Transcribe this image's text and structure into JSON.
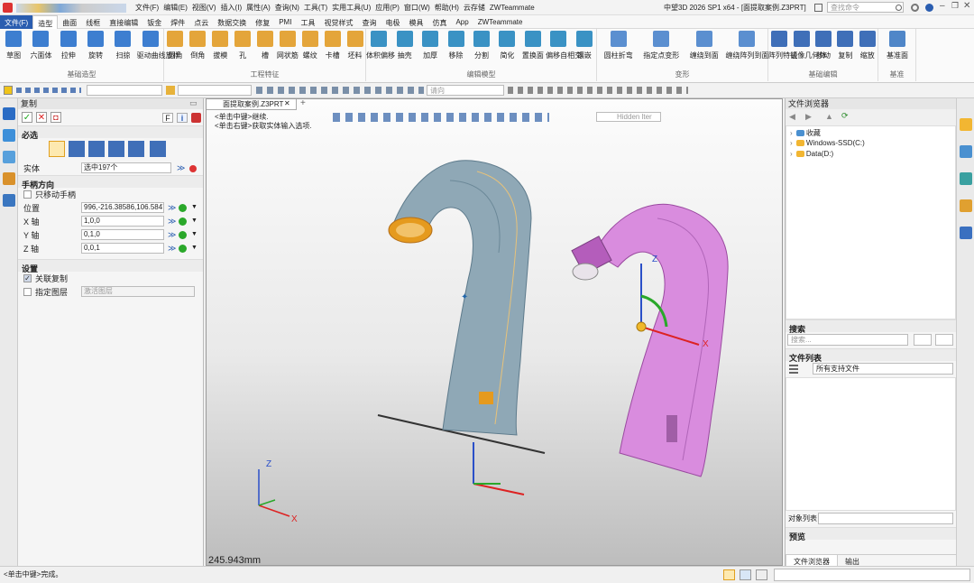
{
  "title_bar": {
    "quick_access_label": "文件(F)",
    "quick_menu": [
      "文件(F)",
      "编辑(E)",
      "视图(V)",
      "插入(I)",
      "属性(A)",
      "查询(N)",
      "工具(T)",
      "实用工具(U)",
      "应用(P)",
      "窗口(W)",
      "帮助(H)",
      "云存储",
      "ZWTeammate"
    ],
    "window_title": "中望3D 2026 SP1 x64 - [面提取案例.Z3PRT]",
    "search_placeholder": "查找命令"
  },
  "tabs": [
    "文件(F)",
    "造型",
    "曲面",
    "线框",
    "直接编辑",
    "钣金",
    "焊件",
    "点云",
    "数据交换",
    "修复",
    "PMI",
    "工具",
    "视觉样式",
    "查询",
    "电极",
    "模具",
    "仿真",
    "App",
    "ZWTeammate"
  ],
  "ribbon": {
    "groups": [
      {
        "label": "基础造型",
        "buttons": [
          "草图",
          "六面体",
          "拉伸",
          "旋转",
          "扫掠",
          "驱动曲线放样"
        ]
      },
      {
        "label": "工程特征",
        "buttons": [
          "圆角",
          "倒角",
          "拔模",
          "孔",
          "槽",
          "网状筋",
          "螺纹",
          "卡槽",
          "坯料"
        ]
      },
      {
        "label": "编辑模型",
        "buttons": [
          "体积偏移",
          "抽壳",
          "加厚",
          "移除",
          "分割",
          "简化",
          "置换面",
          "偏移自相交",
          "镶嵌"
        ]
      },
      {
        "label": "变形",
        "buttons": [
          "圆柱折弯",
          "指定点变形",
          "缠绕到面",
          "缠绕阵列到面"
        ]
      },
      {
        "label": "基础编辑",
        "buttons": [
          "阵列特征",
          "镜像几何体",
          "移动",
          "复制",
          "缩放"
        ]
      },
      {
        "label": "基准",
        "buttons": [
          "基准面"
        ]
      }
    ]
  },
  "toolbar2": {
    "filter_value": "",
    "type_value": "",
    "layer_placeholder": "请向"
  },
  "left_panel": {
    "title": "复制",
    "help_buttons": [
      "F",
      "i"
    ],
    "sec_required": "必选",
    "entity_label": "实体",
    "entity_value": "选中197个",
    "sec_handle": "手柄方向",
    "only_move_handle": "只移动手柄",
    "fields": [
      {
        "label": "位置",
        "value": "996,-216.38586,106.58471"
      },
      {
        "label": "X 轴",
        "value": "1,0,0"
      },
      {
        "label": "Y 轴",
        "value": "0,1,0"
      },
      {
        "label": "Z 轴",
        "value": "0,0,1"
      }
    ],
    "sec_settings": "设置",
    "assoc_copy": "关联复制",
    "assign_layer": "指定图层",
    "layer_value": "激活图层"
  },
  "viewport": {
    "tab_label": "面提取案例.Z3PRT",
    "hint_line1": "<单击中键>继续.",
    "hint_line2": "<单击右键>获取实体输入选项.",
    "render_mode": "Hidden lter",
    "scale": "245.943mm",
    "axis_x": "X",
    "axis_y": "Y",
    "axis_z": "Z",
    "handle_x": "X",
    "handle_z": "Z",
    "colors": {
      "spout_blue": "#8fa8b6",
      "spout_pink": "#d98cde",
      "highlight": "#e59a1e"
    }
  },
  "right_panel": {
    "title": "文件浏览器",
    "tree": [
      "收藏",
      "Windows-SSD(C:)",
      "Data(D:)"
    ],
    "search_title": "搜索",
    "search_placeholder": "搜索...",
    "file_list_title": "文件列表",
    "file_filter": "所有支持文件",
    "object_list_label": "对象列表",
    "preview_title": "预览",
    "bottom_tabs": [
      "文件浏览器",
      "输出"
    ]
  },
  "status": {
    "message": "<单击中键>完成。"
  }
}
